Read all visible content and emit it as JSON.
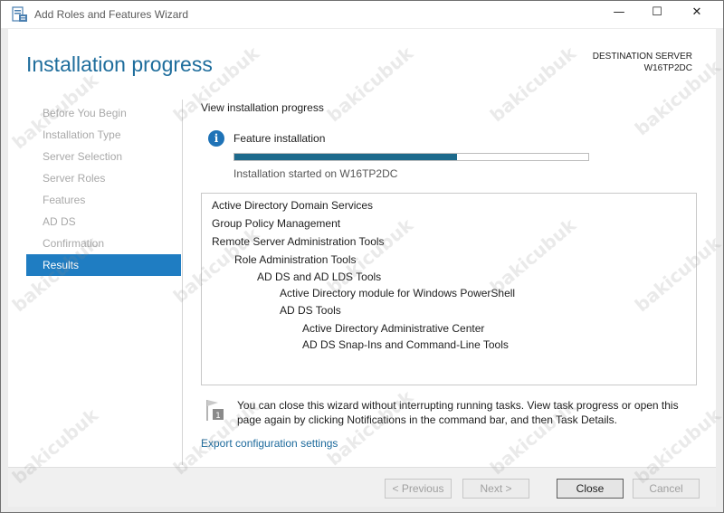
{
  "window": {
    "title": "Add Roles and Features Wizard",
    "controls": {
      "minimize": "—",
      "maximize": "☐",
      "close": "✕"
    }
  },
  "header": {
    "title": "Installation progress",
    "destination_label": "DESTINATION SERVER",
    "destination_server": "W16TP2DC"
  },
  "sidebar": {
    "items": [
      {
        "label": "Before You Begin",
        "active": false
      },
      {
        "label": "Installation Type",
        "active": false
      },
      {
        "label": "Server Selection",
        "active": false
      },
      {
        "label": "Server Roles",
        "active": false
      },
      {
        "label": "Features",
        "active": false
      },
      {
        "label": "AD DS",
        "active": false
      },
      {
        "label": "Confirmation",
        "active": false
      },
      {
        "label": "Results",
        "active": true
      }
    ]
  },
  "main": {
    "view_label": "View installation progress",
    "feature_label": "Feature installation",
    "progress_fraction": 0.63,
    "started_text": "Installation started on W16TP2DC",
    "results": [
      {
        "text": "Active Directory Domain Services",
        "level": 0
      },
      {
        "text": "Group Policy Management",
        "level": 0
      },
      {
        "text": "Remote Server Administration Tools",
        "level": 0
      },
      {
        "text": "Role Administration Tools",
        "level": 1
      },
      {
        "text": "AD DS and AD LDS Tools",
        "level": 2
      },
      {
        "text": "Active Directory module for Windows PowerShell",
        "level": 3
      },
      {
        "text": "AD DS Tools",
        "level": 3
      },
      {
        "text": "Active Directory Administrative Center",
        "level": 4
      },
      {
        "text": "AD DS Snap-Ins and Command-Line Tools",
        "level": 4
      }
    ],
    "note": "You can close this wizard without interrupting running tasks. View task progress or open this page again by clicking Notifications in the command bar, and then Task Details.",
    "note_badge": "1",
    "export_link": "Export configuration settings"
  },
  "footer": {
    "previous": "< Previous",
    "next": "Next >",
    "close": "Close",
    "cancel": "Cancel"
  },
  "watermark": "bakicubuk",
  "colors": {
    "accent": "#1e6d9c",
    "nav_active": "#1f7dc2",
    "progress": "#1d6a8c"
  }
}
